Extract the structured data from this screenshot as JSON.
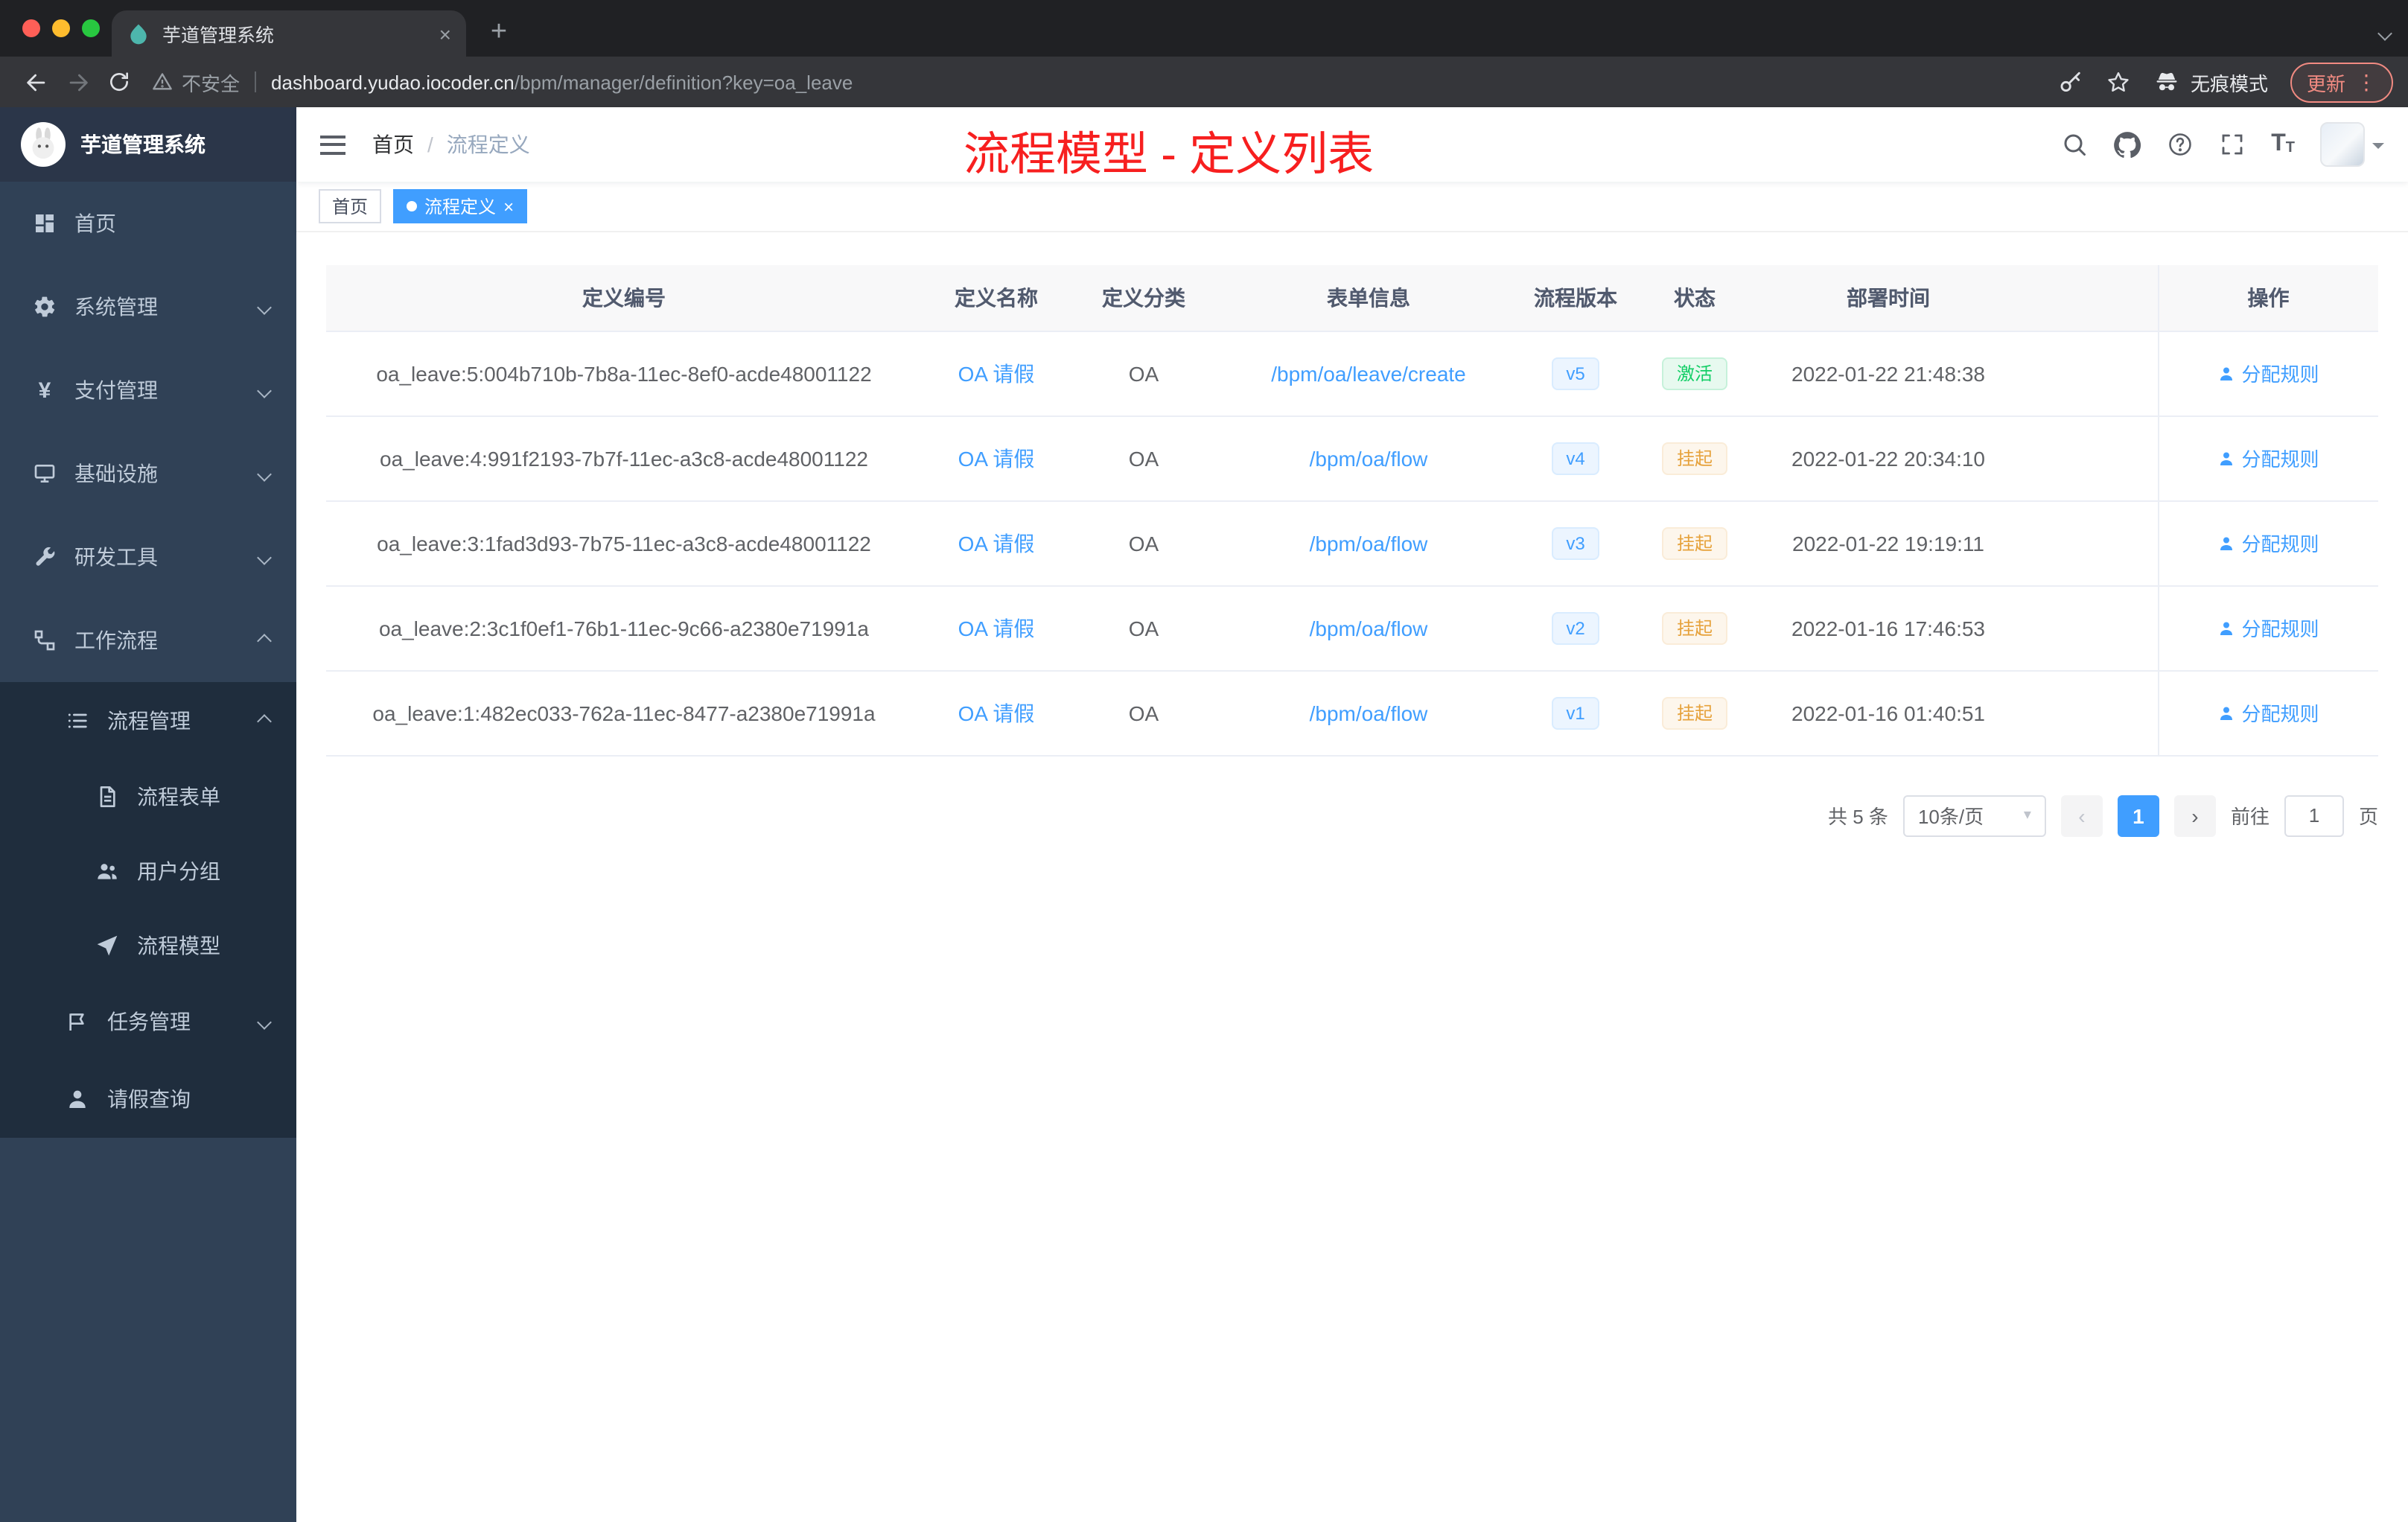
{
  "colors": {
    "accent": "#409eff",
    "annotation_red": "#f71f1f",
    "sidebar_bg": "#304156",
    "submenu_bg": "#1f2d3d",
    "success_green": "#13ce66",
    "warning_orange": "#e6a23c"
  },
  "icons": {
    "close": "×",
    "plus": "+",
    "prev": "‹",
    "next": "›",
    "caret": "▾",
    "kebab": "⋮",
    "yen": "¥",
    "font_big": "T",
    "font_small": "T"
  },
  "browser": {
    "tab_title": "芋道管理系统",
    "security_label": "不安全",
    "url_domain": "dashboard.yudao.iocoder.cn",
    "url_path": "/bpm/manager/definition?key=oa_leave",
    "incognito_label": "无痕模式",
    "update_label": "更新"
  },
  "sidebar": {
    "logo_title": "芋道管理系统",
    "menu": [
      {
        "label": "首页",
        "icon": "dashboard-icon"
      },
      {
        "label": "系统管理",
        "icon": "gear-icon"
      },
      {
        "label": "支付管理",
        "icon": "yen-icon"
      },
      {
        "label": "基础设施",
        "icon": "monitor-icon"
      },
      {
        "label": "研发工具",
        "icon": "tools-icon"
      },
      {
        "label": "工作流程",
        "icon": "workflow-icon"
      },
      {
        "label": "流程管理",
        "icon": "list-icon"
      },
      {
        "label": "流程表单",
        "icon": "form-icon"
      },
      {
        "label": "用户分组",
        "icon": "users-icon"
      },
      {
        "label": "流程模型",
        "icon": "paper-plane-icon"
      },
      {
        "label": "任务管理",
        "icon": "task-icon"
      },
      {
        "label": "请假查询",
        "icon": "person-icon"
      }
    ]
  },
  "header": {
    "breadcrumb_home": "首页",
    "breadcrumb_separator": "/",
    "breadcrumb_current": "流程定义",
    "annotation": "流程模型 - 定义列表"
  },
  "tags": {
    "home": "首页",
    "active": "流程定义"
  },
  "table": {
    "columns": [
      "定义编号",
      "定义名称",
      "定义分类",
      "表单信息",
      "流程版本",
      "状态",
      "部署时间",
      "操作"
    ],
    "rows": [
      {
        "id": "oa_leave:5:004b710b-7b8a-11ec-8ef0-acde48001122",
        "name": "OA 请假",
        "category": "OA",
        "form": "/bpm/oa/leave/create",
        "version": "v5",
        "status": "激活",
        "time": "2022-01-22 21:48:38",
        "action": "分配规则"
      },
      {
        "id": "oa_leave:4:991f2193-7b7f-11ec-a3c8-acde48001122",
        "name": "OA 请假",
        "category": "OA",
        "form": "/bpm/oa/flow",
        "version": "v4",
        "status": "挂起",
        "time": "2022-01-22 20:34:10",
        "action": "分配规则"
      },
      {
        "id": "oa_leave:3:1fad3d93-7b75-11ec-a3c8-acde48001122",
        "name": "OA 请假",
        "category": "OA",
        "form": "/bpm/oa/flow",
        "version": "v3",
        "status": "挂起",
        "time": "2022-01-22 19:19:11",
        "action": "分配规则"
      },
      {
        "id": "oa_leave:2:3c1f0ef1-76b1-11ec-9c66-a2380e71991a",
        "name": "OA 请假",
        "category": "OA",
        "form": "/bpm/oa/flow",
        "version": "v2",
        "status": "挂起",
        "time": "2022-01-16 17:46:53",
        "action": "分配规则"
      },
      {
        "id": "oa_leave:1:482ec033-762a-11ec-8477-a2380e71991a",
        "name": "OA 请假",
        "category": "OA",
        "form": "/bpm/oa/flow",
        "version": "v1",
        "status": "挂起",
        "time": "2022-01-16 01:40:51",
        "action": "分配规则"
      }
    ]
  },
  "pagination": {
    "total": "共 5 条",
    "page_size": "10条/页",
    "page": "1",
    "goto_label": "前往",
    "goto_value": "1",
    "goto_unit": "页"
  }
}
